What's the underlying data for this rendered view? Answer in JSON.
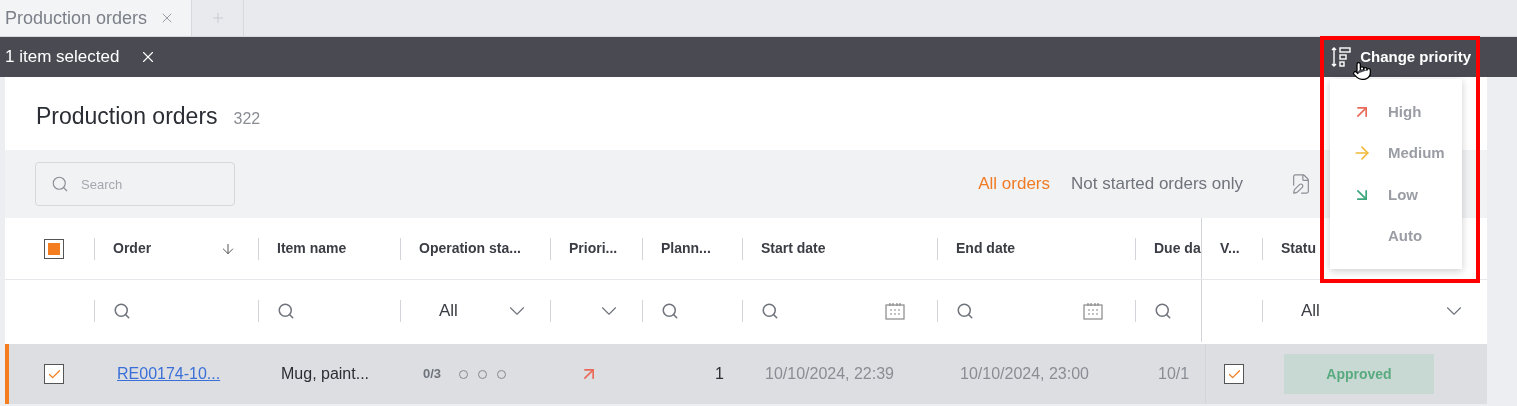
{
  "tabs": [
    {
      "label": "Production orders",
      "selected": true
    }
  ],
  "selection_bar": {
    "text": "1 item selected",
    "action": "Change priority"
  },
  "page": {
    "title": "Production orders",
    "count": "322"
  },
  "search": {
    "placeholder": "Search"
  },
  "filters": [
    {
      "label": "All orders",
      "selected": true
    },
    {
      "label": "Not started orders only",
      "selected": false
    }
  ],
  "select_all": {
    "partial": true
  },
  "columns": [
    {
      "label": "Order",
      "sorted": true
    },
    {
      "label": "Item name",
      "sorted": false
    },
    {
      "label": "Operation sta...",
      "sorted": false
    },
    {
      "label": "Priori...",
      "sorted": false
    },
    {
      "label": "Plann...",
      "sorted": false
    },
    {
      "label": "Start date",
      "sorted": false
    },
    {
      "label": "End date",
      "sorted": false
    },
    {
      "label": "Due da",
      "sorted": false
    },
    {
      "label": "V...",
      "sorted": false
    },
    {
      "label": "Statu",
      "sorted": false
    }
  ],
  "column_filters": [
    {
      "kind": "search"
    },
    {
      "kind": "search"
    },
    {
      "kind": "select",
      "value": "All"
    },
    {
      "kind": "select"
    },
    {
      "kind": "search"
    },
    {
      "kind": "date"
    },
    {
      "kind": "date"
    },
    {
      "kind": "search"
    },
    {
      "kind": "none"
    },
    {
      "kind": "select",
      "value": "All"
    }
  ],
  "rows": [
    {
      "selected": true,
      "order": "RE00174-10...",
      "item": "Mug, paint...",
      "operations": "0/3",
      "steps": [
        {
          "done": false
        },
        {
          "done": false
        },
        {
          "done": false
        }
      ],
      "priority": {
        "kind": "high"
      },
      "planned": "1",
      "start": "10/10/2024, 22:39",
      "end": "10/10/2024, 23:00",
      "due": "10/1",
      "verified": true,
      "status": "Approved"
    }
  ],
  "priority_menu": [
    {
      "kind": "high",
      "label": "High"
    },
    {
      "kind": "medium",
      "label": "Medium"
    },
    {
      "kind": "low",
      "label": "Low"
    },
    {
      "kind": "auto",
      "label": "Auto"
    }
  ]
}
